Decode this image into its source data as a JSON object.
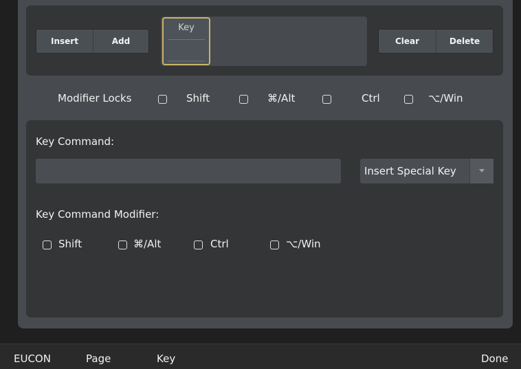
{
  "toolbar": {
    "insert_label": "Insert",
    "add_label": "Add",
    "clear_label": "Clear",
    "delete_label": "Delete"
  },
  "key_slot": {
    "label": "Key"
  },
  "modifier_locks": {
    "label": "Modifier Locks",
    "options": [
      "Shift",
      "⌘/Alt",
      "Ctrl",
      "⌥/Win"
    ]
  },
  "key_command": {
    "label": "Key Command:",
    "value": "",
    "special_key_select": "Insert Special Key"
  },
  "key_command_modifier": {
    "label": "Key Command Modifier:",
    "options": [
      "Shift",
      "⌘/Alt",
      "Ctrl",
      "⌥/Win"
    ]
  },
  "status_bar": {
    "items": [
      "EUCON",
      "Page",
      "Key"
    ],
    "done_label": "Done"
  },
  "colors": {
    "panel": "#474b4f",
    "box": "#333536",
    "accent_key_border": "#c9b469"
  }
}
